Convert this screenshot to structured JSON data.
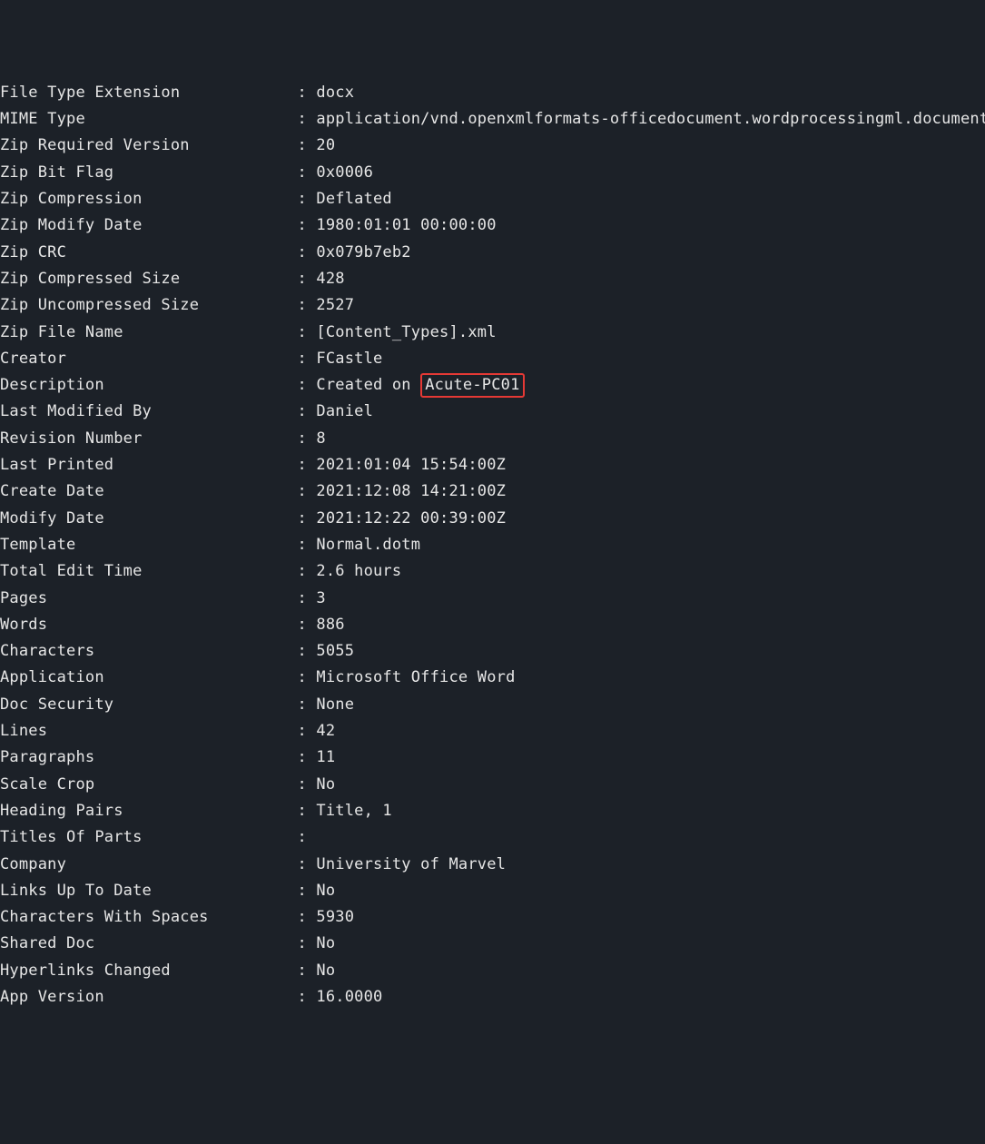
{
  "separator": ": ",
  "rows": [
    {
      "key": "File Type Extension",
      "value": "docx"
    },
    {
      "key": "MIME Type",
      "value": "application/vnd.openxmlformats-officedocument.wordprocessingml.document"
    },
    {
      "key": "Zip Required Version",
      "value": "20"
    },
    {
      "key": "Zip Bit Flag",
      "value": "0x0006"
    },
    {
      "key": "Zip Compression",
      "value": "Deflated"
    },
    {
      "key": "Zip Modify Date",
      "value": "1980:01:01 00:00:00"
    },
    {
      "key": "Zip CRC",
      "value": "0x079b7eb2"
    },
    {
      "key": "Zip Compressed Size",
      "value": "428"
    },
    {
      "key": "Zip Uncompressed Size",
      "value": "2527"
    },
    {
      "key": "Zip File Name",
      "value": "[Content_Types].xml"
    },
    {
      "key": "Creator",
      "value": "FCastle"
    },
    {
      "key": "Description",
      "value_prefix": "Created on ",
      "highlight": "Acute-PC01"
    },
    {
      "key": "Last Modified By",
      "value": "Daniel"
    },
    {
      "key": "Revision Number",
      "value": "8"
    },
    {
      "key": "Last Printed",
      "value": "2021:01:04 15:54:00Z"
    },
    {
      "key": "Create Date",
      "value": "2021:12:08 14:21:00Z"
    },
    {
      "key": "Modify Date",
      "value": "2021:12:22 00:39:00Z"
    },
    {
      "key": "Template",
      "value": "Normal.dotm"
    },
    {
      "key": "Total Edit Time",
      "value": "2.6 hours"
    },
    {
      "key": "Pages",
      "value": "3"
    },
    {
      "key": "Words",
      "value": "886"
    },
    {
      "key": "Characters",
      "value": "5055"
    },
    {
      "key": "Application",
      "value": "Microsoft Office Word"
    },
    {
      "key": "Doc Security",
      "value": "None"
    },
    {
      "key": "Lines",
      "value": "42"
    },
    {
      "key": "Paragraphs",
      "value": "11"
    },
    {
      "key": "Scale Crop",
      "value": "No"
    },
    {
      "key": "Heading Pairs",
      "value": "Title, 1"
    },
    {
      "key": "Titles Of Parts",
      "value": ""
    },
    {
      "key": "Company",
      "value": "University of Marvel"
    },
    {
      "key": "Links Up To Date",
      "value": "No"
    },
    {
      "key": "Characters With Spaces",
      "value": "5930"
    },
    {
      "key": "Shared Doc",
      "value": "No"
    },
    {
      "key": "Hyperlinks Changed",
      "value": "No"
    },
    {
      "key": "App Version",
      "value": "16.0000"
    }
  ]
}
